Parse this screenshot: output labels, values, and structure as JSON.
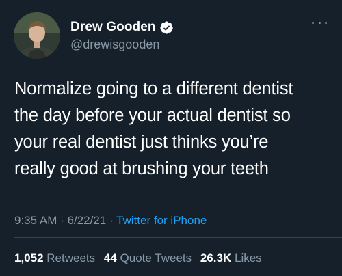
{
  "author": {
    "display_name": "Drew Gooden",
    "handle": "@drewisgooden",
    "verified_icon": "verified-badge-icon"
  },
  "tweet": {
    "lines": [
      "Normalize going to a different dentist",
      "the day before your actual dentist so",
      "your real dentist just thinks you’re",
      "really good at brushing your teeth"
    ],
    "time": "9:35 AM",
    "date": "6/22/21",
    "separator": "·",
    "source": "Twitter for iPhone"
  },
  "stats": {
    "retweets_count": "1,052",
    "retweets_label": "Retweets",
    "quote_tweets_count": "44",
    "quote_tweets_label": "Quote Tweets",
    "likes_count": "26.3K",
    "likes_label": "Likes"
  },
  "colors": {
    "background": "#15202b",
    "text": "#ffffff",
    "muted": "#8899a6",
    "link": "#1da1f2",
    "verified": "#ffffff"
  }
}
